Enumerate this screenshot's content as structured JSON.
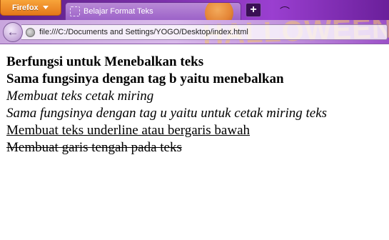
{
  "browser": {
    "menu_button_label": "Firefox",
    "tab_title": "Belajar Format Teks",
    "new_tab_label": "+",
    "url": "file:///C:/Documents and Settings/YOGO/Desktop/index.html",
    "theme_banner_text": "HALLOWEEN"
  },
  "page": {
    "lines": [
      "Berfungsi untuk Menebalkan teks",
      "Sama fungsinya dengan tag b yaitu menebalkan",
      "Membuat teks cetak miring",
      "Sama fungsinya dengan tag u yaitu untuk cetak miring teks",
      "Membuat teks underline atau bergaris bawah",
      "Membuat garis tengah pada teks"
    ]
  }
}
